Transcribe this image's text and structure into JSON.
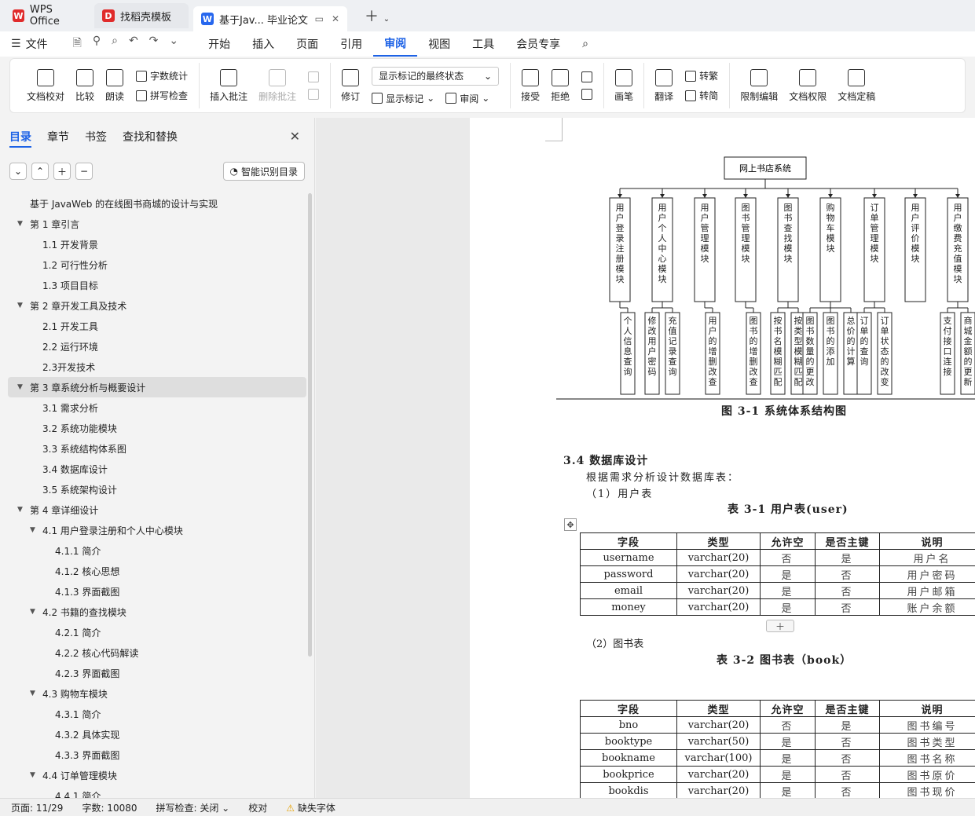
{
  "tabs": {
    "wps_label": "WPS Office",
    "template_label": "找稻壳模板",
    "doc_label": "基于Jav... 毕业论文"
  },
  "menu": {
    "file": "文件",
    "items": [
      "开始",
      "插入",
      "页面",
      "引用",
      "审阅",
      "视图",
      "工具",
      "会员专享"
    ],
    "active": "审阅"
  },
  "ribbon": {
    "doc_check": "文档校对",
    "compare": "比较",
    "read_aloud": "朗读",
    "word_count": "字数统计",
    "spell_check": "拼写检查",
    "insert_comment": "插入批注",
    "delete_comment": "删除批注",
    "track": "修订",
    "markup_state": "显示标记的最终状态",
    "show_markup": "显示标记",
    "review": "审阅",
    "accept": "接受",
    "reject": "拒绝",
    "ink": "画笔",
    "translate": "翻译",
    "to_traditional": "转繁",
    "to_simplified": "转简",
    "restrict_edit": "限制编辑",
    "doc_permission": "文档权限",
    "doc_finalize": "文档定稿"
  },
  "nav": {
    "tabs": [
      "目录",
      "章节",
      "书签",
      "查找和替换"
    ],
    "smart_toc": "智能识别目录",
    "toc": [
      {
        "level": 0,
        "label": "基于 JavaWeb 的在线图书商城的设计与实现",
        "caret": ""
      },
      {
        "level": 0,
        "label": "第 1 章引言",
        "caret": "▼"
      },
      {
        "level": 1,
        "label": "1.1  开发背景",
        "caret": ""
      },
      {
        "level": 1,
        "label": "1.2  可行性分析",
        "caret": ""
      },
      {
        "level": 1,
        "label": "1.3  项目目标",
        "caret": ""
      },
      {
        "level": 0,
        "label": "第 2 章开发工具及技术",
        "caret": "▼"
      },
      {
        "level": 1,
        "label": "2.1 开发工具",
        "caret": ""
      },
      {
        "level": 1,
        "label": "2.2 运行环境",
        "caret": ""
      },
      {
        "level": 1,
        "label": "2.3开发技术",
        "caret": ""
      },
      {
        "level": 0,
        "label": "第 3 章系统分析与概要设计",
        "caret": "▼",
        "selected": true
      },
      {
        "level": 1,
        "label": "3.1  需求分析",
        "caret": ""
      },
      {
        "level": 1,
        "label": "3.2  系统功能模块",
        "caret": ""
      },
      {
        "level": 1,
        "label": "3.3  系统结构体系图",
        "caret": ""
      },
      {
        "level": 1,
        "label": "3.4  数据库设计",
        "caret": ""
      },
      {
        "level": 1,
        "label": "3.5  系统架构设计",
        "caret": ""
      },
      {
        "level": 0,
        "label": "第 4 章详细设计",
        "caret": "▼"
      },
      {
        "level": 1,
        "label": "4.1  用户登录注册和个人中心模块",
        "caret": "▼"
      },
      {
        "level": 2,
        "label": "4.1.1  简介",
        "caret": ""
      },
      {
        "level": 2,
        "label": "4.1.2  核心思想",
        "caret": ""
      },
      {
        "level": 2,
        "label": "4.1.3 界面截图",
        "caret": ""
      },
      {
        "level": 1,
        "label": "4.2 书籍的查找模块",
        "caret": "▼"
      },
      {
        "level": 2,
        "label": "4.2.1  简介",
        "caret": ""
      },
      {
        "level": 2,
        "label": "4.2.2  核心代码解读",
        "caret": ""
      },
      {
        "level": 2,
        "label": "4.2.3 界面截图",
        "caret": ""
      },
      {
        "level": 1,
        "label": "4.3  购物车模块",
        "caret": "▼"
      },
      {
        "level": 2,
        "label": "4.3.1  简介",
        "caret": ""
      },
      {
        "level": 2,
        "label": "4.3.2  具体实现",
        "caret": ""
      },
      {
        "level": 2,
        "label": "4.3.3 界面截图",
        "caret": ""
      },
      {
        "level": 1,
        "label": "4.4 订单管理模块",
        "caret": "▼"
      },
      {
        "level": 2,
        "label": "4.4.1 简介",
        "caret": ""
      }
    ]
  },
  "doc": {
    "diagram": {
      "root": "网上书店系统",
      "modules": [
        {
          "label": "用户登录注册模块",
          "children": [
            "个人信息查询"
          ]
        },
        {
          "label": "用户个人中心模块",
          "children": [
            "修改用户密码",
            "充值记录查询"
          ]
        },
        {
          "label": "用户管理模块",
          "children": [
            "用户的增删改查"
          ]
        },
        {
          "label": "图书管理模块",
          "children": [
            "图书的增删改查"
          ]
        },
        {
          "label": "图书查找模块",
          "children": [
            "按书名模糊匹配",
            "按类型模糊匹配"
          ]
        },
        {
          "label": "购物车模块",
          "children": [
            "图书数量的更改",
            "图书的添加",
            "总价的计算"
          ]
        },
        {
          "label": "订单管理模块",
          "children": [
            "订单的查询",
            "订单状态的改变"
          ]
        },
        {
          "label": "用户评价模块",
          "children": []
        },
        {
          "label": "用户缴费充值模块",
          "children": [
            "支付接口连接",
            "商城金额的更新"
          ]
        }
      ]
    },
    "fig_caption": "图 3-1 系统体系结构图",
    "section": "3.4  数据库设计",
    "intro": "根据需求分析设计数据库表：",
    "t1_label": "（1）用户表",
    "t1_caption": "表 3-1  用户表(user)",
    "headers": [
      "字段",
      "类型",
      "允许空",
      "是否主键",
      "说明"
    ],
    "t1_rows": [
      [
        "username",
        "varchar(20)",
        "否",
        "是",
        "用户名"
      ],
      [
        "password",
        "varchar(20)",
        "是",
        "否",
        "用户密码"
      ],
      [
        "email",
        "varchar(20)",
        "是",
        "否",
        "用户邮箱"
      ],
      [
        "money",
        "varchar(20)",
        "是",
        "否",
        "账户余额"
      ]
    ],
    "t2_label": "（2）图书表",
    "t2_caption": "表 3-2  图书表（book）",
    "t2_rows": [
      [
        "bno",
        "varchar(20)",
        "否",
        "是",
        "图书编号"
      ],
      [
        "booktype",
        "varchar(50)",
        "是",
        "否",
        "图书类型"
      ],
      [
        "bookname",
        "varchar(100)",
        "是",
        "否",
        "图书名称"
      ],
      [
        "bookprice",
        "varchar(20)",
        "是",
        "否",
        "图书原价"
      ],
      [
        "bookdis",
        "varchar(20)",
        "是",
        "否",
        "图书现价"
      ]
    ]
  },
  "status": {
    "page": "页面: 11/29",
    "words": "字数: 10080",
    "spell": "拼写检查: 关闭",
    "proof": "校对",
    "missing_font": "缺失字体"
  }
}
